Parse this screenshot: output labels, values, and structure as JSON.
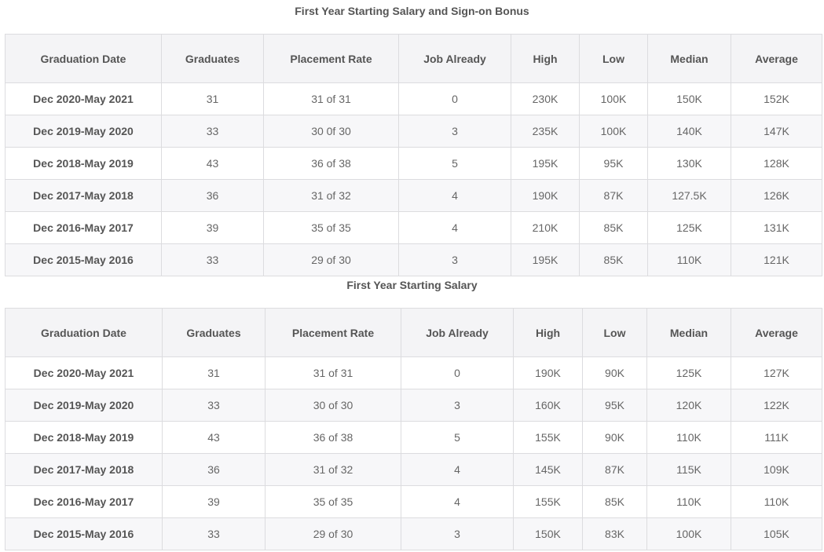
{
  "tables": [
    {
      "title": "First Year Starting Salary and Sign-on Bonus",
      "headers": [
        "Graduation Date",
        "Graduates",
        "Placement Rate",
        "Job Already",
        "High",
        "Low",
        "Median",
        "Average"
      ],
      "rows": [
        [
          "Dec 2020-May 2021",
          "31",
          "31 of 31",
          "0",
          "230K",
          "100K",
          "150K",
          "152K"
        ],
        [
          "Dec 2019-May 2020",
          "33",
          "30 0f 30",
          "3",
          "235K",
          "100K",
          "140K",
          "147K"
        ],
        [
          "Dec 2018-May 2019",
          "43",
          "36 of 38",
          "5",
          "195K",
          "95K",
          "130K",
          "128K"
        ],
        [
          "Dec 2017-May 2018",
          "36",
          "31 of 32",
          "4",
          "190K",
          "87K",
          "127.5K",
          "126K"
        ],
        [
          "Dec 2016-May 2017",
          "39",
          "35 of 35",
          "4",
          "210K",
          "85K",
          "125K",
          "131K"
        ],
        [
          "Dec 2015-May 2016",
          "33",
          "29 of 30",
          "3",
          "195K",
          "85K",
          "110K",
          "121K"
        ]
      ]
    },
    {
      "title": "First Year Starting Salary",
      "headers": [
        "Graduation Date",
        "Graduates",
        "Placement Rate",
        "Job Already",
        "High",
        "Low",
        "Median",
        "Average"
      ],
      "rows": [
        [
          "Dec 2020-May 2021",
          "31",
          "31 of 31",
          "0",
          "190K",
          "90K",
          "125K",
          "127K"
        ],
        [
          "Dec 2019-May 2020",
          "33",
          "30 of 30",
          "3",
          "160K",
          "95K",
          "120K",
          "122K"
        ],
        [
          "Dec 2018-May 2019",
          "43",
          "36 of 38",
          "5",
          "155K",
          "90K",
          "110K",
          "111K"
        ],
        [
          "Dec 2017-May 2018",
          "36",
          "31 of 32",
          "4",
          "145K",
          "87K",
          "115K",
          "109K"
        ],
        [
          "Dec 2016-May 2017",
          "39",
          "35 of 35",
          "4",
          "155K",
          "85K",
          "110K",
          "110K"
        ],
        [
          "Dec 2015-May 2016",
          "33",
          "29 of 30",
          "3",
          "150K",
          "83K",
          "100K",
          "105K"
        ]
      ]
    }
  ]
}
